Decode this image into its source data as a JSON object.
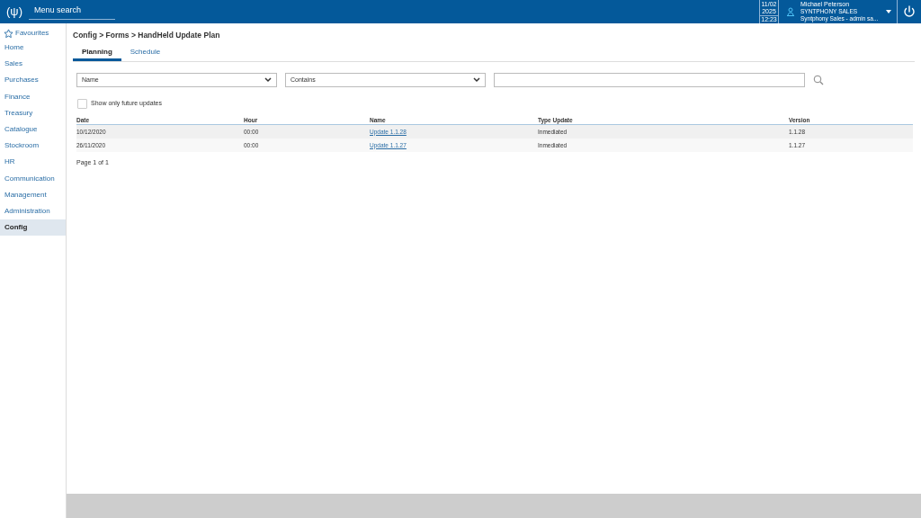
{
  "top_bar": {
    "logo": "(ψ)",
    "menu_search": {
      "placeholder": "Menu search"
    },
    "date": {
      "day_month": "11/02",
      "year": "2025",
      "time": "12:23"
    },
    "user": {
      "name": "Michael Peterson",
      "company": "SYNTPHONY SALES",
      "role": "Syntphony Sales - admin sa..."
    }
  },
  "sidebar": {
    "favourites": "Favourites",
    "items": [
      {
        "label": "Home",
        "selected": false
      },
      {
        "label": "Sales",
        "selected": false
      },
      {
        "label": "Purchases",
        "selected": false
      },
      {
        "label": "Finance",
        "selected": false
      },
      {
        "label": "Treasury",
        "selected": false
      },
      {
        "label": "Catalogue",
        "selected": false
      },
      {
        "label": "Stockroom",
        "selected": false
      },
      {
        "label": "HR",
        "selected": false
      },
      {
        "label": "Communication",
        "selected": false
      },
      {
        "label": "Management",
        "selected": false
      },
      {
        "label": "Administration",
        "selected": false
      },
      {
        "label": "Config",
        "selected": true
      }
    ]
  },
  "breadcrumb": "Config > Forms > HandHeld Update Plan",
  "tabs": [
    {
      "label": "Planning",
      "selected": true
    },
    {
      "label": "Schedule",
      "selected": false
    }
  ],
  "filter": {
    "field": "Name",
    "operator": "Contains"
  },
  "future_only": {
    "label": "Show only future updates",
    "checked": false
  },
  "table": {
    "columns": [
      "Date",
      "Hour",
      "Name",
      "Type Update",
      "Version"
    ],
    "rows": [
      {
        "date": "10/12/2020",
        "hour": "00:00",
        "name": "Update 1.1.28",
        "type": "Inmediated",
        "version": "1.1.28"
      },
      {
        "date": "26/11/2020",
        "hour": "00:00",
        "name": "Update 1.1.27",
        "type": "Inmediated",
        "version": "1.1.27"
      }
    ]
  },
  "pager": "Page 1 of 1"
}
